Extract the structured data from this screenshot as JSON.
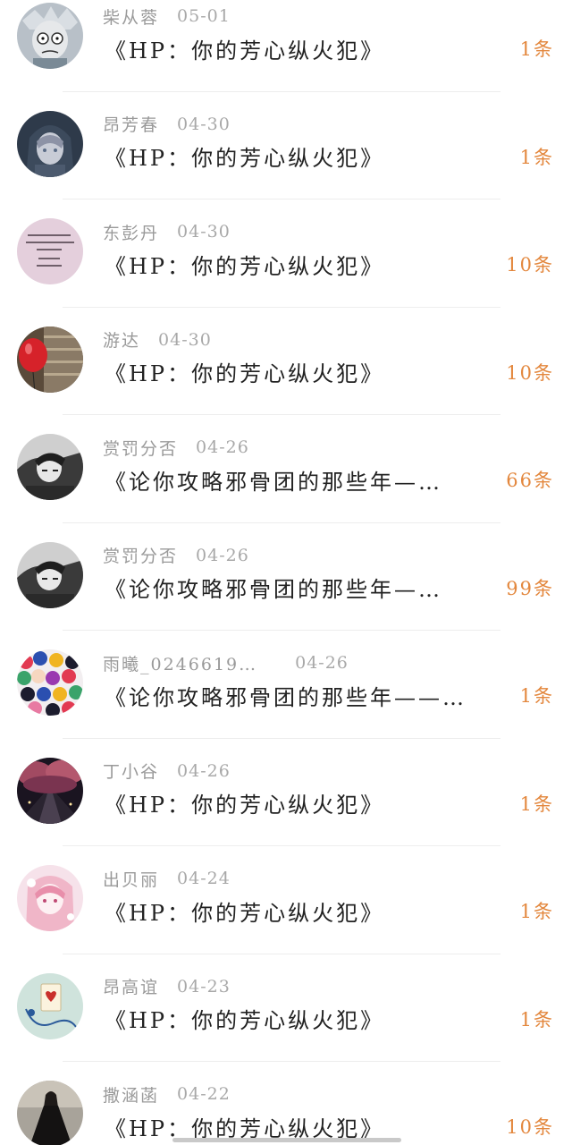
{
  "comments": [
    {
      "user": "柴从蓉",
      "date": "05-01",
      "title": "《HP：你的芳心纵火犯》",
      "count": "1条",
      "avatar": "cartoon-scientist-avatar"
    },
    {
      "user": "昂芳春",
      "date": "04-30",
      "title": "《HP：你的芳心纵火犯》",
      "count": "1条",
      "avatar": "hooded-anime-avatar"
    },
    {
      "user": "东彭丹",
      "date": "04-30",
      "title": "《HP：你的芳心纵火犯》",
      "count": "10条",
      "avatar": "pink-text-avatar"
    },
    {
      "user": "游达",
      "date": "04-30",
      "title": "《HP：你的芳心纵火犯》",
      "count": "10条",
      "avatar": "red-balloon-avatar"
    },
    {
      "user": "赏罚分否",
      "date": "04-26",
      "title": "《论你攻略邪骨团的那些年—…",
      "count": "66条",
      "avatar": "sketch-character-avatar"
    },
    {
      "user": "赏罚分否",
      "date": "04-26",
      "title": "《论你攻略邪骨团的那些年—…",
      "count": "99条",
      "avatar": "sketch-character-avatar"
    },
    {
      "user": "雨曦_0246619…",
      "date": "04-26",
      "title": "《论你攻略邪骨团的那些年——…",
      "count": "1条",
      "avatar": "colorful-crowd-avatar"
    },
    {
      "user": "丁小谷",
      "date": "04-26",
      "title": "《HP：你的芳心纵火犯》",
      "count": "1条",
      "avatar": "night-blossom-avatar"
    },
    {
      "user": "出贝丽",
      "date": "04-24",
      "title": "《HP：你的芳心纵火犯》",
      "count": "1条",
      "avatar": "pink-anime-girl-avatar"
    },
    {
      "user": "昂高谊",
      "date": "04-23",
      "title": "《HP：你的芳心纵火犯》",
      "count": "1条",
      "avatar": "playing-card-avatar"
    },
    {
      "user": "撒涵菡",
      "date": "04-22",
      "title": "《HP：你的芳心纵火犯》",
      "count": "10条",
      "avatar": "dark-dress-avatar"
    }
  ],
  "colors": {
    "background": "#ffffff",
    "username": "#9a9a9a",
    "title": "#222222",
    "count": "#e3873d",
    "divider": "#ededed"
  }
}
